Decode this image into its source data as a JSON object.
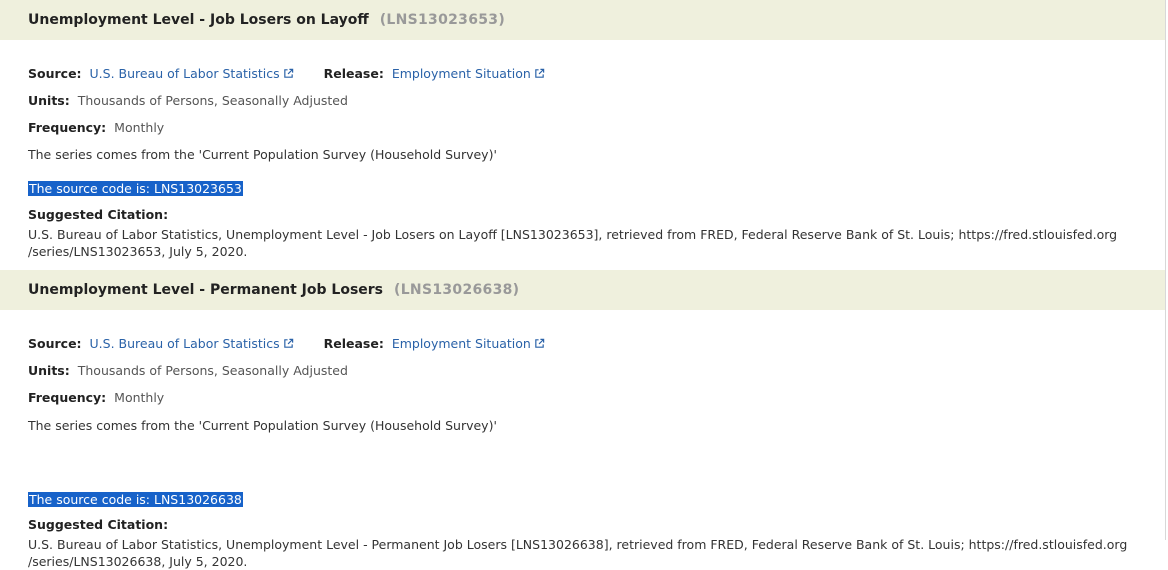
{
  "series": [
    {
      "title": "Unemployment Level - Job Losers on Layoff",
      "id": "(LNS13023653)",
      "source_label": "Source:",
      "source_link": "U.S. Bureau of Labor Statistics",
      "release_label": "Release:",
      "release_link": "Employment Situation",
      "units_label": "Units:",
      "units_value": "Thousands of Persons, Seasonally Adjusted",
      "frequency_label": "Frequency:",
      "frequency_value": "Monthly",
      "note": "The series comes from the 'Current Population Survey (Household Survey)'",
      "source_code": "The source code is: LNS13023653",
      "citation_label": "Suggested Citation:",
      "citation_line1": "U.S. Bureau of Labor Statistics, Unemployment Level - Job Losers on Layoff [LNS13023653], retrieved from FRED, Federal Reserve Bank of St. Louis; https://fred.stlouisfed.org",
      "citation_line2": "/series/LNS13023653, July 5, 2020."
    },
    {
      "title": "Unemployment Level - Permanent Job Losers",
      "id": "(LNS13026638)",
      "source_label": "Source:",
      "source_link": "U.S. Bureau of Labor Statistics",
      "release_label": "Release:",
      "release_link": "Employment Situation",
      "units_label": "Units:",
      "units_value": "Thousands of Persons, Seasonally Adjusted",
      "frequency_label": "Frequency:",
      "frequency_value": "Monthly",
      "note": "The series comes from the 'Current Population Survey (Household Survey)'",
      "source_code": "The source code is: LNS13026638",
      "citation_label": "Suggested Citation:",
      "citation_line1": "U.S. Bureau of Labor Statistics, Unemployment Level - Permanent Job Losers [LNS13026638], retrieved from FRED, Federal Reserve Bank of St. Louis; https://fred.stlouisfed.org",
      "citation_line2": "/series/LNS13026638, July 5, 2020."
    }
  ],
  "colors": {
    "header_bg": "#eff0dd",
    "link": "#2a62a8",
    "selection": "#1762c9"
  },
  "icons": [
    "external-link-icon"
  ]
}
